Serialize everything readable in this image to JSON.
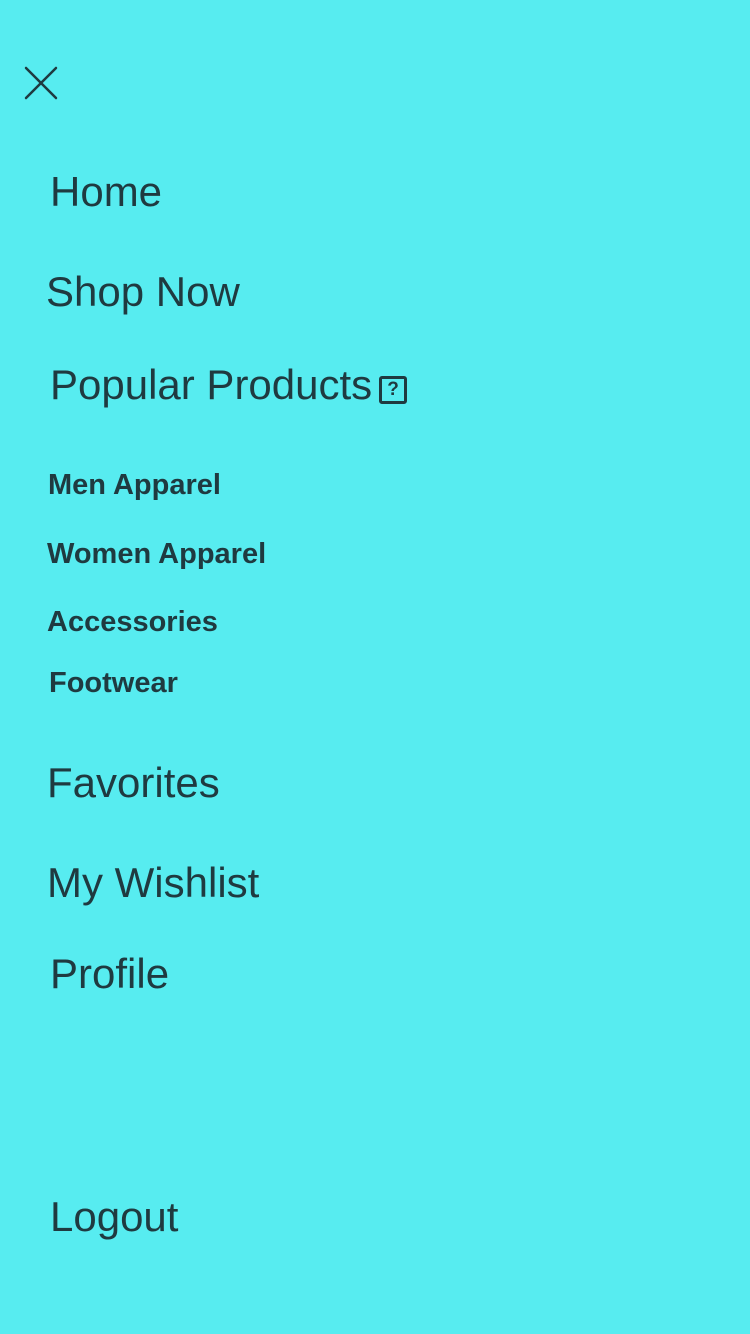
{
  "colors": {
    "background": "#57ECF0",
    "text": "#1F3A40"
  },
  "header": {
    "close_icon": "close-icon"
  },
  "menu": {
    "home": "Home",
    "shop_now": "Shop Now",
    "popular_products": "Popular Products",
    "popular_help_icon": "?",
    "categories": [
      "Men Apparel",
      "Women Apparel",
      "Accessories",
      "Footwear"
    ],
    "favorites": "Favorites",
    "wishlist": "My Wishlist",
    "profile": "Profile",
    "logout": "Logout"
  }
}
